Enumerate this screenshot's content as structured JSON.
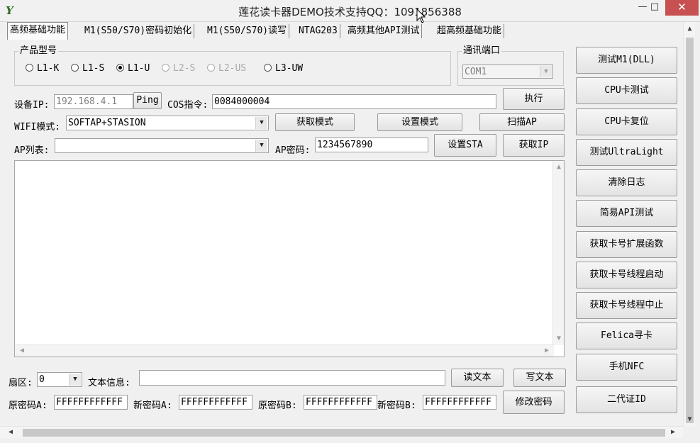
{
  "window": {
    "title": "莲花读卡器DEMO技术支持QQ：1091856388",
    "icon_glyph": "Y",
    "minimize_glyph": "—",
    "maximize_glyph": "□",
    "close_glyph": "✕"
  },
  "tabs": [
    "高频基础功能",
    "M1(S50/S70)密码初始化",
    "M1(S50/S70)读写",
    "NTAG203",
    "高频其他API测试",
    "超高频基础功能"
  ],
  "product": {
    "label": "产品型号",
    "options": [
      "L1-K",
      "L1-S",
      "L1-U",
      "L2-S",
      "L2-US",
      "L3-UW"
    ],
    "selected": "L1-U"
  },
  "comm": {
    "label": "通讯端口",
    "value": "COM1"
  },
  "device": {
    "ip_label": "设备IP:",
    "ip_value": "192.168.4.1",
    "ping_label": "Ping",
    "cos_label": "COS指令:",
    "cos_value": "0084000004",
    "execute_label": "执行"
  },
  "wifi": {
    "mode_label": "WIFI模式:",
    "mode_value": "SOFTAP+STASION",
    "get_mode_label": "获取模式",
    "set_mode_label": "设置模式",
    "scan_label": "扫描AP"
  },
  "ap": {
    "list_label": "AP列表:",
    "list_value": "",
    "password_label": "AP密码:",
    "password_value": "1234567890",
    "set_sta_label": "设置STA",
    "get_ip_label": "获取IP"
  },
  "sector": {
    "label": "扇区:",
    "value": "0"
  },
  "text_info": {
    "label": "文本信息:",
    "value": "",
    "read_label": "读文本",
    "write_label": "写文本"
  },
  "keys": {
    "old_a_label": "原密码A:",
    "old_a_value": "FFFFFFFFFFFF",
    "new_a_label": "新密码A:",
    "new_a_value": "FFFFFFFFFFFF",
    "old_b_label": "原密码B:",
    "old_b_value": "FFFFFFFFFFFF",
    "new_b_label": "新密码B:",
    "new_b_value": "FFFFFFFFFFFF",
    "change_label": "修改密码"
  },
  "side_buttons": [
    "测试M1(DLL)",
    "CPU卡测试",
    "CPU卡复位",
    "测试UltraLight",
    "清除日志",
    "简易API测试",
    "获取卡号扩展函数",
    "获取卡号线程启动",
    "获取卡号线程中止",
    "Felica寻卡",
    "手机NFC",
    "二代证ID"
  ],
  "scroll_arrows": {
    "up": "▲",
    "down": "▼",
    "left": "◀",
    "right": "▶"
  }
}
